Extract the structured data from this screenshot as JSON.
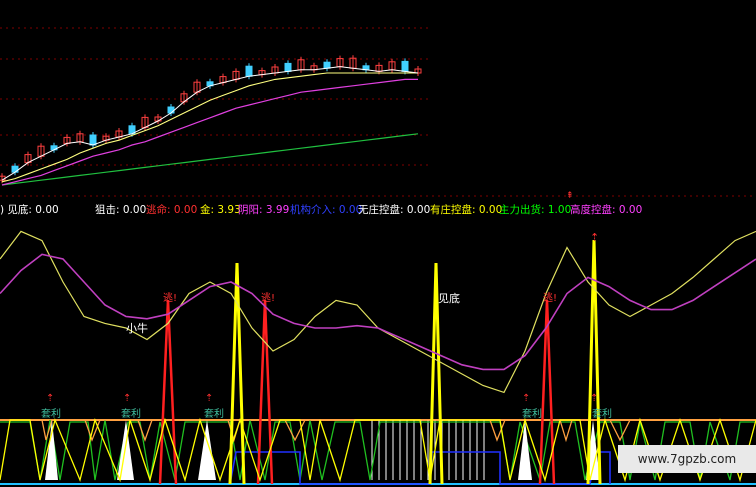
{
  "indicator_bar": [
    {
      "text": ") 见底: 0.00",
      "color": "#ffffff"
    },
    {
      "text": "狙击: 0.00",
      "color": "#ffffff"
    },
    {
      "text": "逃命: 0.00",
      "color": "#ff3030"
    },
    {
      "text": "金: 3.93",
      "color": "#ffff00"
    },
    {
      "text": "阴阳: 3.99",
      "color": "#ff40ff"
    },
    {
      "text": "机构介入: 0.00",
      "color": "#3040ff"
    },
    {
      "text": "无庄控盘: 0.00",
      "color": "#ffffff"
    },
    {
      "text": "有庄控盘: 0.00",
      "color": "#ffff00"
    },
    {
      "text": "主力出货: 1.00",
      "color": "#00ff00"
    },
    {
      "text": "高度控盘: 0.00",
      "color": "#ff40ff"
    }
  ],
  "chart_labels": {
    "xiaoniu": "小牛",
    "jiandi": "见底",
    "tao_top": "逃!",
    "taoli": "套利"
  },
  "watermark": "www.7gpzb.com",
  "colors": {
    "background": "#000000",
    "candle_up": "#ff4040",
    "candle_down": "#40d0ff",
    "ma5": "#ffffff",
    "ma10": "#ffff80",
    "ma20": "#e040e0",
    "ma60": "#20c040",
    "grid": "#800000",
    "yellow": "#ffff00",
    "magenta": "#c040c0",
    "red": "#ff2020",
    "green": "#20c020",
    "blue": "#2030ff",
    "orange": "#ffa040",
    "teal": "#40c0a0",
    "white": "#ffffff"
  },
  "chart_data": [
    {
      "type": "candlestick",
      "title": "",
      "series": [
        {
          "name": "",
          "values": [
            3,
            8,
            14,
            18,
            22,
            26,
            27,
            25,
            28,
            30,
            32,
            36,
            40,
            45,
            52,
            58,
            62,
            64,
            66,
            68,
            69,
            70,
            71,
            72,
            72,
            73,
            74,
            73,
            72,
            71,
            72,
            71,
            70
          ]
        },
        {
          "name": "",
          "values": [
            2,
            4,
            7,
            10,
            13,
            16,
            20,
            23,
            26,
            28,
            31,
            34,
            37,
            41,
            45,
            49,
            53,
            56,
            59,
            62,
            64,
            66,
            67,
            68,
            69,
            70,
            70,
            70,
            70,
            70,
            70,
            70,
            70
          ]
        },
        {
          "name": "",
          "values": [
            0,
            2,
            4,
            6,
            9,
            12,
            15,
            18,
            20,
            22,
            25,
            27,
            30,
            33,
            36,
            39,
            42,
            45,
            48,
            50,
            52,
            54,
            56,
            58,
            59,
            60,
            61,
            62,
            63,
            64,
            65,
            66,
            66
          ]
        },
        {
          "name": "",
          "values": [
            0,
            1,
            2,
            3,
            4,
            5,
            6,
            7,
            8,
            9,
            10,
            11,
            12,
            13,
            14,
            15,
            16,
            17,
            18,
            19,
            20,
            21,
            22,
            23,
            24,
            25,
            26,
            27,
            28,
            29,
            30,
            31,
            32
          ]
        }
      ]
    },
    {
      "type": "line",
      "title": "",
      "series": [
        {
          "name": "",
          "values": [
            70,
            82,
            78,
            60,
            45,
            42,
            40,
            35,
            42,
            55,
            60,
            55,
            40,
            30,
            35,
            45,
            52,
            50,
            40,
            35,
            30,
            25,
            20,
            15,
            12,
            30,
            55,
            75,
            60,
            50,
            45,
            50,
            55,
            62,
            70,
            78,
            82
          ]
        },
        {
          "name": "",
          "values": [
            55,
            65,
            72,
            70,
            60,
            50,
            45,
            44,
            46,
            52,
            58,
            60,
            55,
            46,
            42,
            40,
            40,
            41,
            40,
            36,
            32,
            28,
            24,
            22,
            22,
            28,
            40,
            55,
            62,
            58,
            52,
            48,
            48,
            52,
            58,
            64,
            70
          ]
        }
      ],
      "ylim": [
        0,
        100
      ]
    }
  ]
}
